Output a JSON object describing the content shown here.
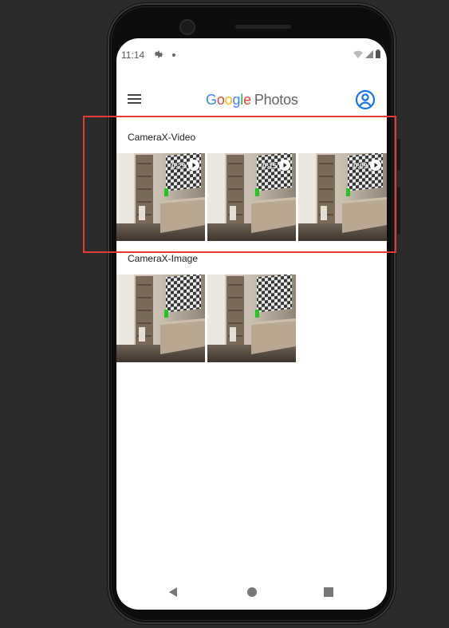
{
  "status_bar": {
    "time": "11:14",
    "icons": [
      "gear-icon",
      "dot-icon",
      "wifi-icon",
      "signal-icon",
      "battery-icon"
    ]
  },
  "app_bar": {
    "logo_google": [
      "G",
      "o",
      "o",
      "g",
      "l",
      "e"
    ],
    "logo_google_colors": [
      "#4285F4",
      "#EA4335",
      "#FBBC05",
      "#4285F4",
      "#34A853",
      "#EA4335"
    ],
    "logo_photos": "Photos",
    "menu_icon": "hamburger-menu-icon",
    "account_icon": "account-circle-icon",
    "accent": "#1a73e8"
  },
  "sections": [
    {
      "title": "CameraX-Video",
      "items": [
        {
          "duration": "0:29",
          "type": "video"
        },
        {
          "duration": "0:15",
          "type": "video"
        },
        {
          "duration": "0:09",
          "type": "video"
        }
      ]
    },
    {
      "title": "CameraX-Image",
      "items": [
        {
          "type": "image"
        },
        {
          "type": "image"
        }
      ]
    }
  ],
  "nav_bar": {
    "back_icon": "back-triangle-icon",
    "home_icon": "home-circle-icon",
    "recents_icon": "recents-square-icon"
  },
  "highlight_color": "#e53935"
}
